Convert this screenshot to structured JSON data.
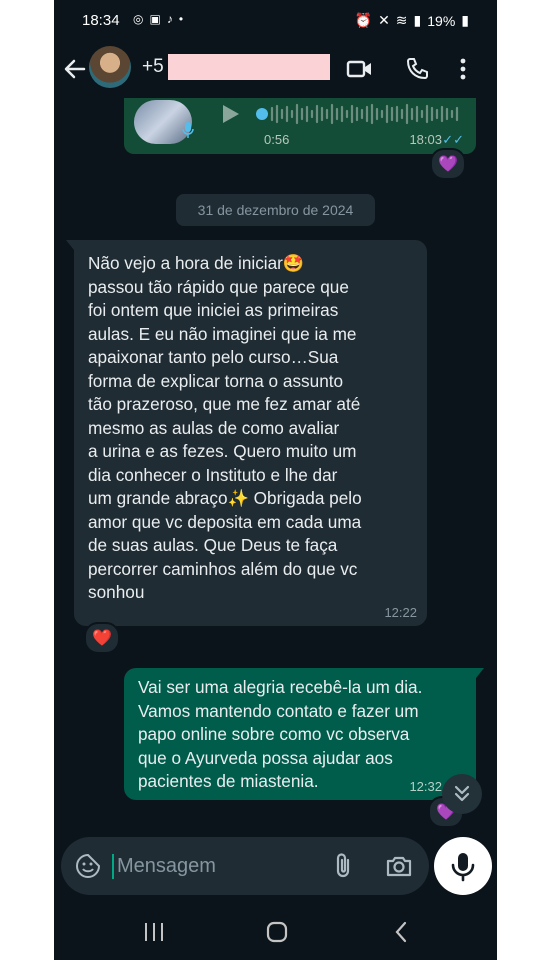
{
  "status_bar": {
    "time": "18:34",
    "battery": "19%"
  },
  "header": {
    "contact_name": "+5"
  },
  "voice_message": {
    "duration": "0:56",
    "time": "18:03",
    "reaction": "💜"
  },
  "date_separator": "31 de dezembro de 2024",
  "incoming_message": {
    "text": "Não vejo a hora de iniciar🤩\npassou tão rápido que parece que\nfoi ontem que iniciei as primeiras\naulas. E eu não imaginei que ia me\napaixonar tanto pelo curso…Sua\nforma de explicar torna o assunto\ntão prazeroso, que me fez amar até\nmesmo as aulas de como avaliar\na urina e as fezes. Quero muito um\ndia conhecer o Instituto e lhe dar\num grande abraço✨ Obrigada pelo\namor que vc deposita em cada uma\nde suas aulas. Que Deus te faça\npercorrer caminhos além do que vc\nsonhou",
    "time": "12:22",
    "reaction": "❤️"
  },
  "outgoing_message": {
    "text": "Vai ser uma alegria recebê-la um dia.\nVamos mantendo contato e fazer um\npapo online sobre como vc observa\nque o Ayurveda possa ajudar aos\npacientes de miastenia.",
    "time": "12:32",
    "reaction": "💜"
  },
  "composer": {
    "placeholder": "Mensagem"
  },
  "colors": {
    "background": "#0b141a",
    "incoming_bubble": "#202c33",
    "outgoing_bubble": "#005c4b",
    "accent": "#00a884",
    "read_ticks": "#53bdeb"
  }
}
